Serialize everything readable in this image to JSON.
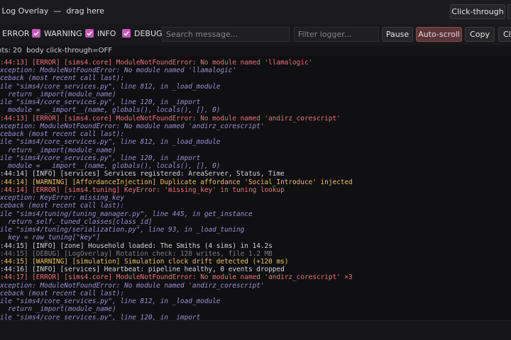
{
  "window": {
    "title": "4 Log Overlay  —  drag here"
  },
  "titlebar": {
    "click_through_label": "Click-through"
  },
  "filters": [
    {
      "label": "ERROR",
      "checked": true
    },
    {
      "label": "WARNING",
      "checked": true
    },
    {
      "label": "INFO",
      "checked": true
    },
    {
      "label": "DEBUG",
      "checked": true
    }
  ],
  "toolbar": {
    "search_placeholder": "Search message...",
    "logger_placeholder": "Filter logger...",
    "pause_label": "Pause",
    "autoscroll_label": "Auto-scroll",
    "copy_label": "Copy",
    "clear_label": "Cl"
  },
  "status": {
    "text": "nts: 20  body click-through=OFF"
  },
  "colors": {
    "accent": "#c857b9",
    "error": "#f0707a",
    "warning": "#f1c05a",
    "info": "#d6d6d6",
    "debug": "#7d7d83",
    "trace": "#9c8ed6",
    "active_button": "#5a3638"
  },
  "log_lines": [
    {
      "text": ":44:13] [ERROR] [sims4.core] ModuleNotFoundError: No module named 'llamalogic'",
      "level": "error"
    },
    {
      "text": "xception: ModuleNotFoundError: No module named 'llamalogic'",
      "level": "trace"
    },
    {
      "text": "ceback (most recent call last):",
      "level": "trace"
    },
    {
      "text": "ile \"sims4/core_services.py\", line 812, in _load_module",
      "level": "trace"
    },
    {
      "text": "  return _import(module_name)",
      "level": "trace"
    },
    {
      "text": "ile \"sims4/core_services.py\", line 120, in _import",
      "level": "trace"
    },
    {
      "text": "  module = __import__(name, globals(), locals(), [], 0)",
      "level": "trace"
    },
    {
      "text": ":44:13] [ERROR] [sims4.core] ModuleNotFoundError: No module named 'andirz_corescript'",
      "level": "error"
    },
    {
      "text": "xception: ModuleNotFoundError: No module named 'andirz_corescript'",
      "level": "trace"
    },
    {
      "text": "ceback (most recent call last):",
      "level": "trace"
    },
    {
      "text": "ile \"sims4/core_services.py\", line 812, in _load_module",
      "level": "trace"
    },
    {
      "text": "  return _import(module_name)",
      "level": "trace"
    },
    {
      "text": "ile \"sims4/core_services.py\", line 120, in _import",
      "level": "trace"
    },
    {
      "text": "  module = __import__(name, globals(), locals(), [], 0)",
      "level": "trace"
    },
    {
      "text": ":44:14] [INFO] [services] Services registered: AreaServer, Status, Time",
      "level": "info"
    },
    {
      "text": ":44:14] [WARNING] [AffordanceInjection] Duplicate affordance 'Social_Introduce' injected",
      "level": "warn"
    },
    {
      "text": ":44:14] [ERROR] [sims4.tuning] KeyError: 'missing_key' in tuning lookup",
      "level": "error"
    },
    {
      "text": "xception: KeyError: missing_key",
      "level": "trace"
    },
    {
      "text": "ceback (most recent call last):",
      "level": "trace"
    },
    {
      "text": "ile \"sims4/tuning/tuning_manager.py\", line 445, in get_instance",
      "level": "trace"
    },
    {
      "text": "  return self._tuned_classes[class_id]",
      "level": "trace"
    },
    {
      "text": "ile \"sims4/tuning/serialization.py\", line 93, in _load_tuning",
      "level": "trace"
    },
    {
      "text": "  key = raw_tuning[\"key\"]",
      "level": "trace"
    },
    {
      "text": ":44:15] [INFO] [zone] Household loaded: The Smiths (4 sims) in 14.2s",
      "level": "info"
    },
    {
      "text": ":44:15] [DEBUG] [LogOverlay] Rotation check: 128 writes, file 1.2 MB",
      "level": "debug"
    },
    {
      "text": ":44:15] [WARNING] [simulation] Simulation clock drift detected (+120 ms)",
      "level": "warn"
    },
    {
      "text": ":44:16] [INFO] [services] Heartbeat: pipeline healthy, 0 events dropped",
      "level": "info"
    },
    {
      "text": ":44:17] [ERROR] [sims4.core] ModuleNotFoundError: No module named 'andirz_corescript' ×3",
      "level": "error"
    },
    {
      "text": "xception: ModuleNotFoundError: No module named 'andirz_corescript'",
      "level": "trace"
    },
    {
      "text": "ceback (most recent call last):",
      "level": "trace"
    },
    {
      "text": "ile \"sims4/core_services.py\", line 812, in _load_module",
      "level": "trace"
    },
    {
      "text": "  return _import(module_name)",
      "level": "trace"
    },
    {
      "text": "ile \"sims4/core_services.py\", line 120, in _import",
      "level": "trace"
    }
  ]
}
